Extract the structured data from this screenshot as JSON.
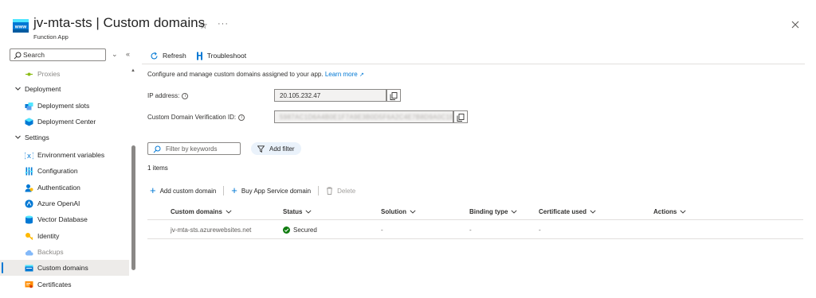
{
  "header": {
    "title": "jv-mta-sts | Custom domains",
    "subtitle": "Function App",
    "star_glyph": "☆",
    "more_glyph": "···",
    "app_icon": "www-globe-icon"
  },
  "sidebar": {
    "search_placeholder": "Search",
    "collapse_all_glyph": "⌄",
    "collapse_pane_glyph": "«",
    "items": [
      {
        "type": "item",
        "label": "Proxies",
        "icon": "proxies-icon",
        "dim": true
      },
      {
        "type": "group",
        "label": "Deployment"
      },
      {
        "type": "item",
        "label": "Deployment slots",
        "icon": "deployment-slots-icon"
      },
      {
        "type": "item",
        "label": "Deployment Center",
        "icon": "deployment-center-icon"
      },
      {
        "type": "group",
        "label": "Settings"
      },
      {
        "type": "item",
        "label": "Environment variables",
        "icon": "environment-variables-icon"
      },
      {
        "type": "item",
        "label": "Configuration",
        "icon": "configuration-icon"
      },
      {
        "type": "item",
        "label": "Authentication",
        "icon": "authentication-icon"
      },
      {
        "type": "item",
        "label": "Azure OpenAI",
        "icon": "azure-openai-icon"
      },
      {
        "type": "item",
        "label": "Vector Database",
        "icon": "vector-database-icon"
      },
      {
        "type": "item",
        "label": "Identity",
        "icon": "identity-icon"
      },
      {
        "type": "item",
        "label": "Backups",
        "icon": "backups-icon",
        "dim": true
      },
      {
        "type": "item",
        "label": "Custom domains",
        "icon": "custom-domains-icon",
        "active": true
      },
      {
        "type": "item",
        "label": "Certificates",
        "icon": "certificates-icon"
      }
    ]
  },
  "toolbar": {
    "refresh_label": "Refresh",
    "troubleshoot_label": "Troubleshoot"
  },
  "content": {
    "intro_text": "Configure and manage custom domains assigned to your app.",
    "learn_more": "Learn more",
    "ip_label": "IP address:",
    "ip_value": "20.105.232.47",
    "verification_label": "Custom Domain Verification ID:",
    "verification_value": "5987AC1D6A4B0E1F7A9E3B0D5F6A2C4E7B8D9A0C1E2F3A4B5C6D7E8F",
    "filter_placeholder": "Filter by keywords",
    "add_filter_label": "Add filter",
    "items_count": "1 items",
    "add_custom_domain": "Add custom domain",
    "buy_domain": "Buy App Service domain",
    "delete_label": "Delete"
  },
  "table": {
    "columns": [
      "Custom domains",
      "Status",
      "Solution",
      "Binding type",
      "Certificate used",
      "Actions"
    ],
    "rows": [
      {
        "domain": "jv-mta-sts.azurewebsites.net",
        "status": "Secured",
        "solution": "-",
        "binding_type": "-",
        "certificate": "-",
        "actions": ""
      }
    ]
  },
  "colors": {
    "accent": "#0078d4",
    "success": "#107c10",
    "active_bg": "#edebe9"
  }
}
